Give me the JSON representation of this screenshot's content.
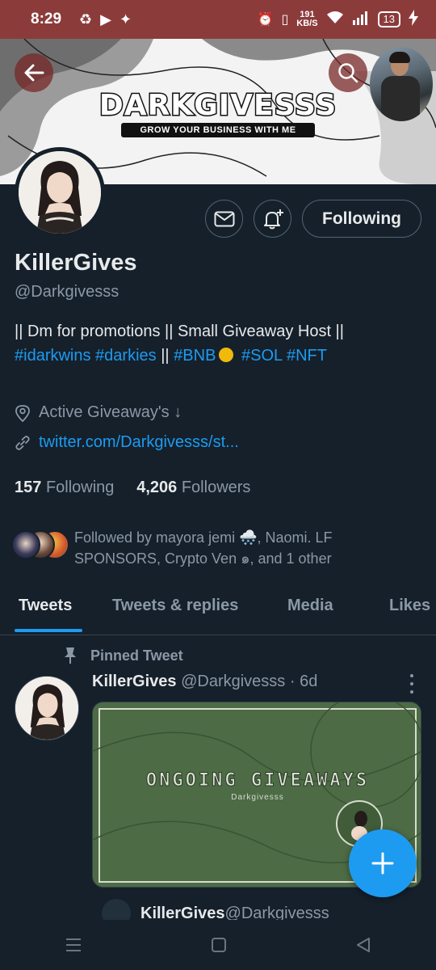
{
  "status_bar": {
    "time": "8:29",
    "net_speed_value": "191",
    "net_speed_unit": "KB/S",
    "battery": "13"
  },
  "banner": {
    "title": "DARKGIVESSS",
    "subtitle": "GROW YOUR BUSINESS WITH ME"
  },
  "profile": {
    "name": "KillerGives",
    "handle": "@Darkgivesss",
    "follow_button": "Following",
    "bio_line1": "|| Dm for promotions || Small Giveaway Host ||",
    "bio_tag1": "#idarkwins",
    "bio_tag2": "#darkies",
    "bio_sep": "||",
    "bio_tag3": "#BNB",
    "bio_tag4": "#SOL",
    "bio_tag5": "#NFT",
    "location": "Active Giveaway's ↓",
    "website": "twitter.com/Darkgivesss/st...",
    "following_count": "157",
    "following_label": "Following",
    "followers_count": "4,206",
    "followers_label": "Followers",
    "followed_by_line1": "Followed by mayora jemi 🌨️, Naomi. LF",
    "followed_by_line2": "SPONSORS, Crypto Ven ๑, and 1 other"
  },
  "tabs": [
    "Tweets",
    "Tweets & replies",
    "Media",
    "Likes"
  ],
  "tweet": {
    "pinned_label": "Pinned Tweet",
    "author_name": "KillerGives",
    "author_meta": "@Darkgivesss · 6d",
    "media_title": "ONGOING GIVEAWAYS",
    "media_sub": "Darkgivesss",
    "quote_name": "KillerGives",
    "quote_handle": "@Darkgivesss"
  },
  "colors": {
    "background": "#15202b",
    "accent": "#1d9bf0",
    "status_bar": "#8c3b3b"
  }
}
